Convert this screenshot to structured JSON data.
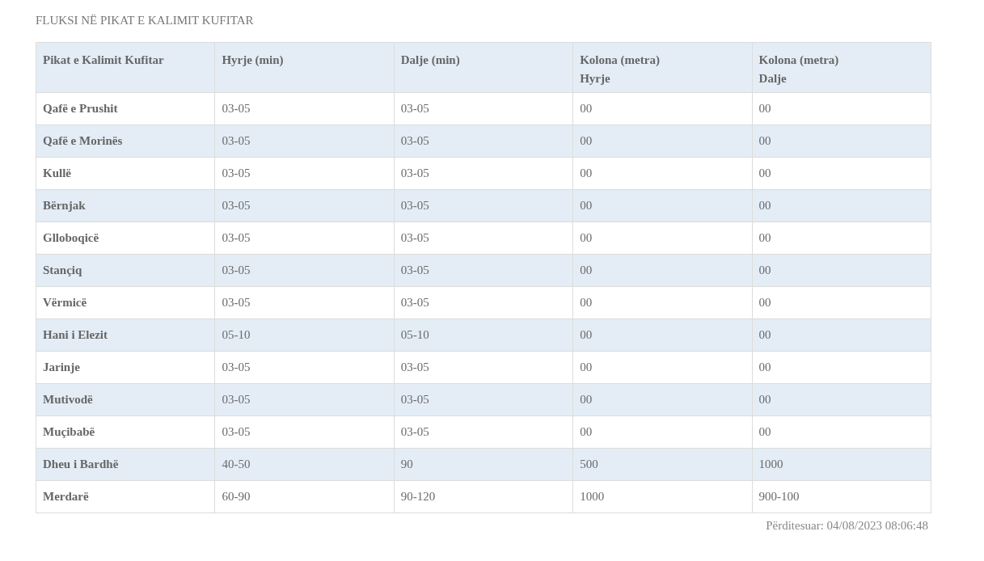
{
  "title": "FLUKSI NË PIKAT E KALIMIT KUFITAR",
  "table": {
    "columns": [
      "Pikat e Kalimit Kufitar",
      "Hyrje (min)",
      "Dalje (min)",
      "Kolona (metra)\nHyrje",
      "Kolona (metra)\nDalje"
    ],
    "rows": [
      [
        "Qafë e Prushit",
        "03-05",
        "03-05",
        "00",
        "00"
      ],
      [
        "Qafë e Morinës",
        "03-05",
        "03-05",
        "00",
        "00"
      ],
      [
        "Kullë",
        "03-05",
        "03-05",
        "00",
        "00"
      ],
      [
        "Bërnjak",
        "03-05",
        "03-05",
        "00",
        "00"
      ],
      [
        "Glloboqicë",
        "03-05",
        "03-05",
        "00",
        "00"
      ],
      [
        "Stançiq",
        "03-05",
        "03-05",
        "00",
        "00"
      ],
      [
        "Vërmicë",
        "03-05",
        "03-05",
        "00",
        "00"
      ],
      [
        "Hani i Elezit",
        "05-10",
        "05-10",
        "00",
        "00"
      ],
      [
        "Jarinje",
        "03-05",
        "03-05",
        "00",
        "00"
      ],
      [
        "Mutivodë",
        "03-05",
        "03-05",
        "00",
        "00"
      ],
      [
        "Muçibabë",
        "03-05",
        "03-05",
        "00",
        "00"
      ],
      [
        "Dheu i Bardhë",
        "40-50",
        "90",
        "500",
        "1000"
      ],
      [
        "Merdarë",
        "60-90",
        "90-120",
        "1000",
        "900-100"
      ]
    ]
  },
  "updated": "Përditesuar: 04/08/2023 08:06:48"
}
